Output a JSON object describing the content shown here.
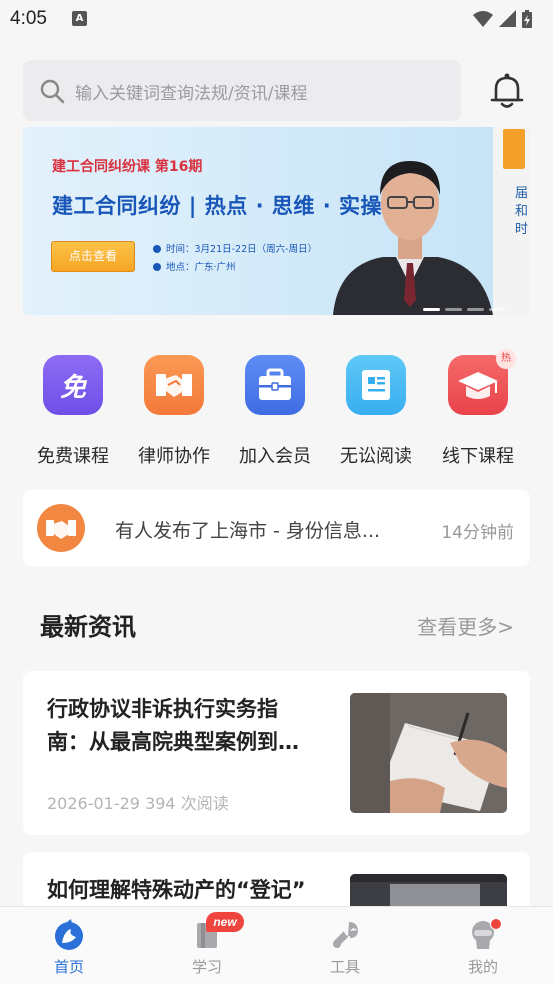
{
  "status_bar": {
    "time": "4:05",
    "notification_glyph": "A",
    "icons": [
      "wifi-icon",
      "signal-icon",
      "battery-icon"
    ]
  },
  "search": {
    "placeholder": "输入关键词查询法规/资讯/课程"
  },
  "banner": {
    "subtitle": "建工合同纠纷课 第16期",
    "title": "建工合同纠纷 | 热点 · 思维 · 实操",
    "button": "点击查看",
    "time_line": "时间：3月21日-22日（周六-周日）",
    "place_line": "地点：广东·广州",
    "next_slide_text": "届\n和\n时",
    "slide_count": 4,
    "active_slide": 0
  },
  "quick_nav": [
    {
      "label": "免费课程",
      "icon": "free-course-icon",
      "glyph": "免",
      "color_top": "#8d6cf5",
      "color_bottom": "#6f4fe6"
    },
    {
      "label": "律师协作",
      "icon": "handshake-icon",
      "color_top": "#fb9a55",
      "color_bottom": "#f2793a"
    },
    {
      "label": "加入会员",
      "icon": "briefcase-icon",
      "color_top": "#5f8df5",
      "color_bottom": "#3f6ce3"
    },
    {
      "label": "无讼阅读",
      "icon": "reading-icon",
      "color_top": "#5fc8f7",
      "color_bottom": "#38aef0"
    },
    {
      "label": "线下课程",
      "icon": "graduation-cap-icon",
      "badge": "热",
      "color_top": "#f56a6a",
      "color_bottom": "#e8434a"
    }
  ],
  "notice": {
    "text": "有人发布了上海市 - 身份信息...",
    "time": "14分钟前"
  },
  "news_section": {
    "title": "最新资讯",
    "more": "查看更多>"
  },
  "news": [
    {
      "title_line1": "行政协议非诉执行实务指",
      "title_line2": "南：从最高院典型案例到…",
      "meta": "2026-01-29 394 次阅读"
    },
    {
      "title_line1": "如何理解特殊动产的“登记”",
      "title_line2": "",
      "meta": ""
    }
  ],
  "tabbar": {
    "tabs": [
      {
        "label": "首页",
        "icon": "home-icon",
        "active": true
      },
      {
        "label": "学习",
        "icon": "study-icon",
        "badge": "new"
      },
      {
        "label": "工具",
        "icon": "wrench-icon"
      },
      {
        "label": "我的",
        "icon": "profile-icon",
        "dot": true
      }
    ]
  },
  "colors": {
    "accent": "#2a70d8",
    "banner_title": "#1856b8",
    "banner_subtitle": "#d9323f",
    "badge_red": "#f0443f"
  }
}
